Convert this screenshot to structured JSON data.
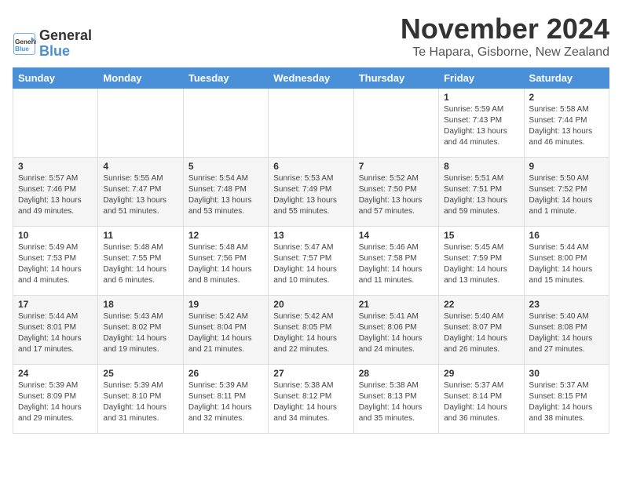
{
  "logo": {
    "text_general": "General",
    "text_blue": "Blue"
  },
  "header": {
    "month_year": "November 2024",
    "location": "Te Hapara, Gisborne, New Zealand"
  },
  "days_of_week": [
    "Sunday",
    "Monday",
    "Tuesday",
    "Wednesday",
    "Thursday",
    "Friday",
    "Saturday"
  ],
  "weeks": [
    [
      {
        "day": "",
        "info": ""
      },
      {
        "day": "",
        "info": ""
      },
      {
        "day": "",
        "info": ""
      },
      {
        "day": "",
        "info": ""
      },
      {
        "day": "",
        "info": ""
      },
      {
        "day": "1",
        "info": "Sunrise: 5:59 AM\nSunset: 7:43 PM\nDaylight: 13 hours\nand 44 minutes."
      },
      {
        "day": "2",
        "info": "Sunrise: 5:58 AM\nSunset: 7:44 PM\nDaylight: 13 hours\nand 46 minutes."
      }
    ],
    [
      {
        "day": "3",
        "info": "Sunrise: 5:57 AM\nSunset: 7:46 PM\nDaylight: 13 hours\nand 49 minutes."
      },
      {
        "day": "4",
        "info": "Sunrise: 5:55 AM\nSunset: 7:47 PM\nDaylight: 13 hours\nand 51 minutes."
      },
      {
        "day": "5",
        "info": "Sunrise: 5:54 AM\nSunset: 7:48 PM\nDaylight: 13 hours\nand 53 minutes."
      },
      {
        "day": "6",
        "info": "Sunrise: 5:53 AM\nSunset: 7:49 PM\nDaylight: 13 hours\nand 55 minutes."
      },
      {
        "day": "7",
        "info": "Sunrise: 5:52 AM\nSunset: 7:50 PM\nDaylight: 13 hours\nand 57 minutes."
      },
      {
        "day": "8",
        "info": "Sunrise: 5:51 AM\nSunset: 7:51 PM\nDaylight: 13 hours\nand 59 minutes."
      },
      {
        "day": "9",
        "info": "Sunrise: 5:50 AM\nSunset: 7:52 PM\nDaylight: 14 hours\nand 1 minute."
      }
    ],
    [
      {
        "day": "10",
        "info": "Sunrise: 5:49 AM\nSunset: 7:53 PM\nDaylight: 14 hours\nand 4 minutes."
      },
      {
        "day": "11",
        "info": "Sunrise: 5:48 AM\nSunset: 7:55 PM\nDaylight: 14 hours\nand 6 minutes."
      },
      {
        "day": "12",
        "info": "Sunrise: 5:48 AM\nSunset: 7:56 PM\nDaylight: 14 hours\nand 8 minutes."
      },
      {
        "day": "13",
        "info": "Sunrise: 5:47 AM\nSunset: 7:57 PM\nDaylight: 14 hours\nand 10 minutes."
      },
      {
        "day": "14",
        "info": "Sunrise: 5:46 AM\nSunset: 7:58 PM\nDaylight: 14 hours\nand 11 minutes."
      },
      {
        "day": "15",
        "info": "Sunrise: 5:45 AM\nSunset: 7:59 PM\nDaylight: 14 hours\nand 13 minutes."
      },
      {
        "day": "16",
        "info": "Sunrise: 5:44 AM\nSunset: 8:00 PM\nDaylight: 14 hours\nand 15 minutes."
      }
    ],
    [
      {
        "day": "17",
        "info": "Sunrise: 5:44 AM\nSunset: 8:01 PM\nDaylight: 14 hours\nand 17 minutes."
      },
      {
        "day": "18",
        "info": "Sunrise: 5:43 AM\nSunset: 8:02 PM\nDaylight: 14 hours\nand 19 minutes."
      },
      {
        "day": "19",
        "info": "Sunrise: 5:42 AM\nSunset: 8:04 PM\nDaylight: 14 hours\nand 21 minutes."
      },
      {
        "day": "20",
        "info": "Sunrise: 5:42 AM\nSunset: 8:05 PM\nDaylight: 14 hours\nand 22 minutes."
      },
      {
        "day": "21",
        "info": "Sunrise: 5:41 AM\nSunset: 8:06 PM\nDaylight: 14 hours\nand 24 minutes."
      },
      {
        "day": "22",
        "info": "Sunrise: 5:40 AM\nSunset: 8:07 PM\nDaylight: 14 hours\nand 26 minutes."
      },
      {
        "day": "23",
        "info": "Sunrise: 5:40 AM\nSunset: 8:08 PM\nDaylight: 14 hours\nand 27 minutes."
      }
    ],
    [
      {
        "day": "24",
        "info": "Sunrise: 5:39 AM\nSunset: 8:09 PM\nDaylight: 14 hours\nand 29 minutes."
      },
      {
        "day": "25",
        "info": "Sunrise: 5:39 AM\nSunset: 8:10 PM\nDaylight: 14 hours\nand 31 minutes."
      },
      {
        "day": "26",
        "info": "Sunrise: 5:39 AM\nSunset: 8:11 PM\nDaylight: 14 hours\nand 32 minutes."
      },
      {
        "day": "27",
        "info": "Sunrise: 5:38 AM\nSunset: 8:12 PM\nDaylight: 14 hours\nand 34 minutes."
      },
      {
        "day": "28",
        "info": "Sunrise: 5:38 AM\nSunset: 8:13 PM\nDaylight: 14 hours\nand 35 minutes."
      },
      {
        "day": "29",
        "info": "Sunrise: 5:37 AM\nSunset: 8:14 PM\nDaylight: 14 hours\nand 36 minutes."
      },
      {
        "day": "30",
        "info": "Sunrise: 5:37 AM\nSunset: 8:15 PM\nDaylight: 14 hours\nand 38 minutes."
      }
    ]
  ]
}
